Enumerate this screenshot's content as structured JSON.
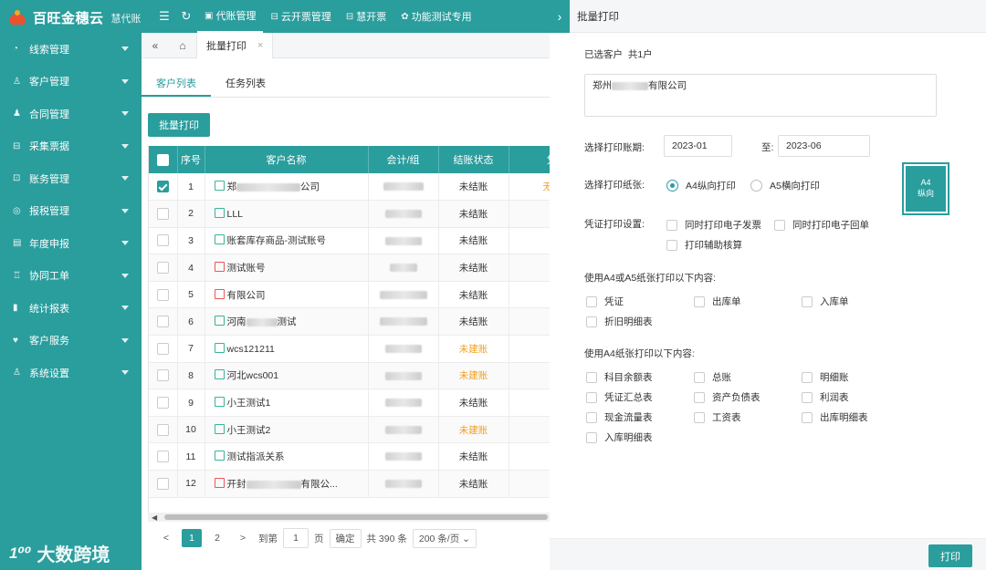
{
  "app": {
    "name": "百旺金穗云",
    "sub": "慧代账"
  },
  "topnav": {
    "items": [
      {
        "icon": "▣",
        "label": "代账管理",
        "active": true
      },
      {
        "icon": "⊟",
        "label": "云开票管理",
        "active": false
      },
      {
        "icon": "⊟",
        "label": "慧开票",
        "active": false
      },
      {
        "icon": "✿",
        "label": "功能测试专用",
        "active": false
      }
    ]
  },
  "sidebar": {
    "items": [
      {
        "icon": "◔",
        "label": "线索管理"
      },
      {
        "icon": "♙",
        "label": "客户管理"
      },
      {
        "icon": "♟",
        "label": "合同管理"
      },
      {
        "icon": "⊟",
        "label": "采集票据"
      },
      {
        "icon": "⊡",
        "label": "账务管理"
      },
      {
        "icon": "◎",
        "label": "报税管理"
      },
      {
        "icon": "▤",
        "label": "年度申报"
      },
      {
        "icon": "♖",
        "label": "协同工单"
      },
      {
        "icon": "▮",
        "label": "统计报表"
      },
      {
        "icon": "♥",
        "label": "客户服务"
      },
      {
        "icon": "♙",
        "label": "系统设置"
      }
    ]
  },
  "watermark": {
    "mark": "1⁰⁰",
    "text": "大数跨境"
  },
  "tabs": {
    "open_tab": "批量打印",
    "close": "×"
  },
  "subtabs": [
    "客户列表",
    "任务列表"
  ],
  "batch_print_label": "批量打印",
  "table": {
    "headers": [
      "",
      "序号",
      "客户名称",
      "会计/组",
      "结账状态",
      "凭证"
    ],
    "rows": [
      {
        "no": "1",
        "name_pre": "郑",
        "name_post": "公司",
        "blur_name": 70,
        "icon": "green",
        "status": "未结账",
        "status_type": "done",
        "extra": "无数据",
        "checked": true
      },
      {
        "no": "2",
        "name_pre": "LLL",
        "name_post": "",
        "blur_name": 0,
        "icon": "green",
        "status": "未结账",
        "status_type": "done",
        "extra": "--",
        "checked": false
      },
      {
        "no": "3",
        "name_pre": "账套库存商品-测试账号",
        "name_post": "",
        "blur_name": 0,
        "icon": "green",
        "status": "未结账",
        "status_type": "done",
        "extra": "--",
        "checked": false
      },
      {
        "no": "4",
        "name_pre": "测试账号",
        "name_post": "",
        "blur_name": 0,
        "icon": "red",
        "status": "未结账",
        "status_type": "done",
        "extra": "--",
        "checked": false
      },
      {
        "no": "5",
        "name_pre": "有限公司",
        "name_post": "",
        "blur_name": 0,
        "icon": "red",
        "status": "未结账",
        "status_type": "done",
        "extra": "--",
        "checked": false
      },
      {
        "no": "6",
        "name_pre": "河南",
        "name_post": "测试",
        "blur_name": 34,
        "icon": "green",
        "status": "未结账",
        "status_type": "done",
        "extra": "--",
        "checked": false
      },
      {
        "no": "7",
        "name_pre": "wcs121211",
        "name_post": "",
        "blur_name": 0,
        "icon": "green",
        "status": "未建账",
        "status_type": "warn",
        "extra": "--",
        "checked": false
      },
      {
        "no": "8",
        "name_pre": "河北wcs001",
        "name_post": "",
        "blur_name": 0,
        "icon": "green",
        "status": "未建账",
        "status_type": "warn",
        "extra": "--",
        "checked": false
      },
      {
        "no": "9",
        "name_pre": "小王测试1",
        "name_post": "",
        "blur_name": 0,
        "icon": "green",
        "status": "未结账",
        "status_type": "done",
        "extra": "--",
        "checked": false
      },
      {
        "no": "10",
        "name_pre": "小王测试2",
        "name_post": "",
        "blur_name": 0,
        "icon": "green",
        "status": "未建账",
        "status_type": "warn",
        "extra": "--",
        "checked": false
      },
      {
        "no": "11",
        "name_pre": "测试指派关系",
        "name_post": "",
        "blur_name": 0,
        "icon": "green",
        "status": "未结账",
        "status_type": "done",
        "extra": "--",
        "checked": false
      },
      {
        "no": "12",
        "name_pre": "开封",
        "name_post": "有限公...",
        "blur_name": 60,
        "icon": "red",
        "status": "未结账",
        "status_type": "done",
        "extra": "--",
        "checked": false
      }
    ]
  },
  "pager": {
    "prev": "<",
    "pages": [
      "1",
      "2"
    ],
    "next": ">",
    "goto": "到第",
    "page_value": "1",
    "page_unit": "页",
    "confirm": "确定",
    "total": "共 390 条",
    "size": "200 条/页"
  },
  "panel": {
    "title": "批量打印",
    "selected_label": "已选客户",
    "selected_count": "共1户",
    "selected_pre": "郑州",
    "selected_post": "有限公司",
    "period_label": "选择打印账期:",
    "period_from": "2023-01",
    "period_to_word": "至:",
    "period_to": "2023-06",
    "paper_label": "选择打印纸张:",
    "paper_a4": "A4纵向打印",
    "paper_a5": "A5横向打印",
    "paper_preview_1": "A4",
    "paper_preview_2": "纵向",
    "voucher_label": "凭证打印设置:",
    "voucher_opts": [
      "同时打印电子发票",
      "同时打印电子回单",
      "打印辅助核算"
    ],
    "a4a5_label": "使用A4或A5纸张打印以下内容:",
    "a4a5_opts": [
      "凭证",
      "出库单",
      "入库单",
      "折旧明细表"
    ],
    "a4_label": "使用A4纸张打印以下内容:",
    "a4_opts": [
      "科目余额表",
      "总账",
      "明细账",
      "凭证汇总表",
      "资产负债表",
      "利润表",
      "现金流量表",
      "工资表",
      "出库明细表",
      "入库明细表"
    ],
    "print_btn": "打印"
  }
}
